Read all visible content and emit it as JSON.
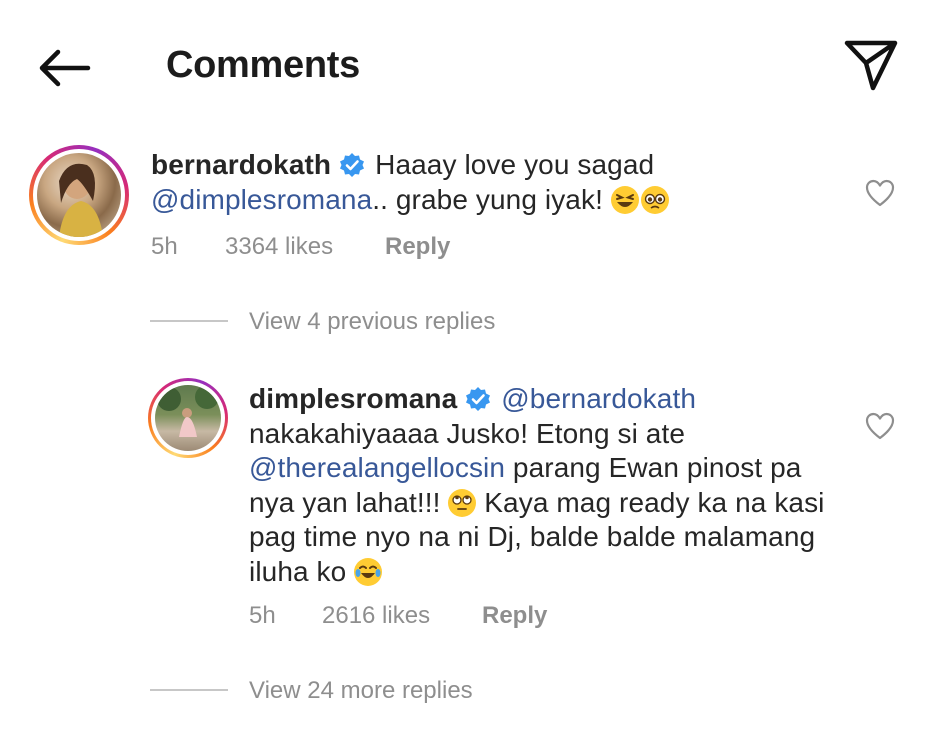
{
  "header": {
    "title": "Comments",
    "back_icon": "arrow-left-icon",
    "share_icon": "paper-plane-icon"
  },
  "comments": [
    {
      "username": "bernardokath",
      "verified": true,
      "text_before": "Haaay love you sagad",
      "mention": "@dimplesromana",
      "text_after": ".. grabe yung iyak! ",
      "emojis": [
        "grinning-squinting-emoji",
        "pleading-emoji"
      ],
      "time": "5h",
      "likes": "3364 likes",
      "reply_label": "Reply",
      "view_replies": "View 4 previous replies"
    },
    {
      "username": "dimplesromana",
      "verified": true,
      "mention_1": "@bernardokath",
      "text_1": "nakakahiyaaaa Jusko! Etong si ate",
      "mention_2": "@therealangellocsin",
      "text_2": " parang Ewan pinost pa nya yan lahat!!! ",
      "text_3": " Kaya mag ready ka na kasi pag time nyo na ni Dj, balde balde malamang iluha ko ",
      "emojis": [
        "eye-roll-emoji",
        "tears-of-joy-emoji"
      ],
      "time": "5h",
      "likes": "2616 likes",
      "reply_label": "Reply",
      "view_replies": "View 24 more replies"
    }
  ],
  "colors": {
    "text": "#262626",
    "muted": "#8e8e8e",
    "mention": "#385898",
    "verified": "#3897f0"
  }
}
